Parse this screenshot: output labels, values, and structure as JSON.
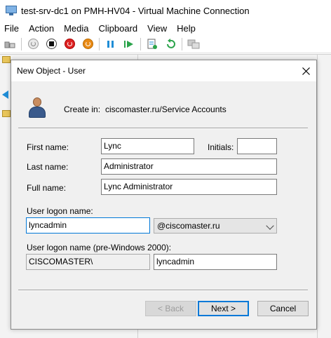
{
  "vm_window": {
    "title": "test-srv-dc1 on PMH-HV04 - Virtual Machine Connection",
    "menu": [
      "File",
      "Action",
      "Media",
      "Clipboard",
      "View",
      "Help"
    ]
  },
  "dialog": {
    "title": "New Object - User",
    "create_in_label": "Create in:",
    "create_in_value": "ciscomaster.ru/Service Accounts",
    "first_name_label": "First name:",
    "first_name_value": "Lync",
    "initials_label": "Initials:",
    "initials_value": "",
    "last_name_label": "Last name:",
    "last_name_value": "Administrator",
    "full_name_label": "Full name:",
    "full_name_value": "Lync Administrator",
    "logon_label": "User logon name:",
    "logon_value": "lyncadmin",
    "domain_value": "@ciscomaster.ru",
    "pre2000_label": "User logon name (pre-Windows 2000):",
    "pre2000_domain": "CISCOMASTER\\",
    "pre2000_value": "lyncadmin",
    "back_label": "< Back",
    "next_label": "Next >",
    "cancel_label": "Cancel"
  }
}
